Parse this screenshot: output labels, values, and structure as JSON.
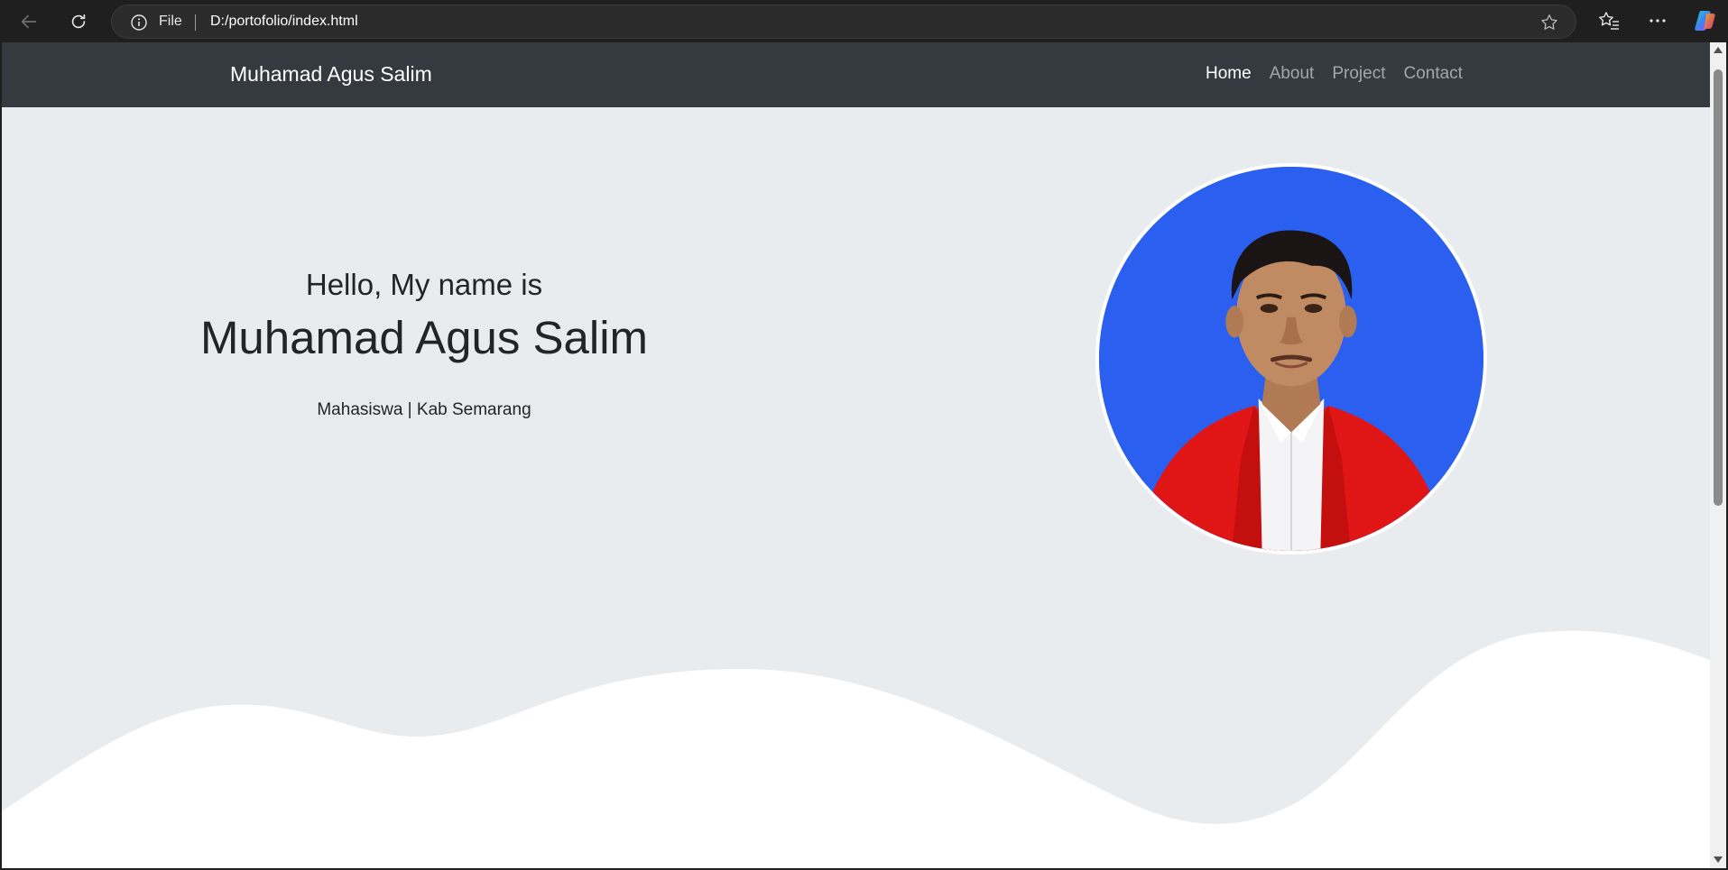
{
  "browser": {
    "scheme_label": "File",
    "url": "D:/portofolio/index.html"
  },
  "navbar": {
    "brand": "Muhamad Agus Salim",
    "links": [
      {
        "label": "Home",
        "active": true
      },
      {
        "label": "About",
        "active": false
      },
      {
        "label": "Project",
        "active": false
      },
      {
        "label": "Contact",
        "active": false
      }
    ]
  },
  "hero": {
    "greeting": "Hello, My name is",
    "name": "Muhamad Agus Salim",
    "tagline": "Mahasiswa | Kab Semarang",
    "photo_background": "#2a5ff0"
  },
  "colors": {
    "navbar_bg": "#343a40",
    "page_bg": "#e9ecef",
    "wave": "#ffffff"
  }
}
